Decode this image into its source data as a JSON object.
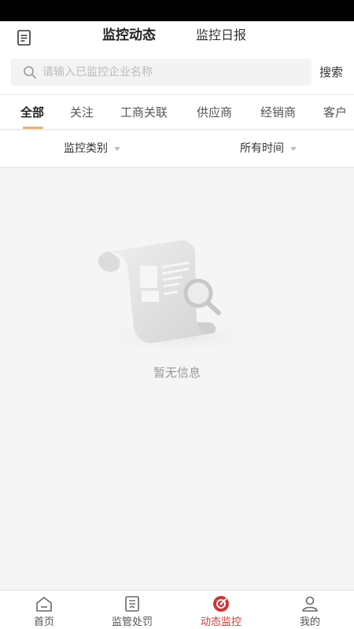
{
  "header": {
    "tabs": [
      {
        "label": "监控动态",
        "active": true
      },
      {
        "label": "监控日报",
        "active": false
      }
    ]
  },
  "search": {
    "placeholder": "请输入已监控企业名称",
    "value": "",
    "button_label": "搜索"
  },
  "categories": [
    {
      "label": "全部",
      "active": true
    },
    {
      "label": "关注"
    },
    {
      "label": "工商关联"
    },
    {
      "label": "供应商"
    },
    {
      "label": "经销商"
    },
    {
      "label": "客户"
    }
  ],
  "filters": {
    "type_label": "监控类别",
    "time_label": "所有时间"
  },
  "empty_state": {
    "message": "暂无信息"
  },
  "tabbar": [
    {
      "label": "首页",
      "icon": "home-icon"
    },
    {
      "label": "监管处罚",
      "icon": "document-icon"
    },
    {
      "label": "动态监控",
      "icon": "monitor-icon",
      "active": true
    },
    {
      "label": "我的",
      "icon": "user-icon"
    }
  ],
  "colors": {
    "accent_underline": "#e8b57b",
    "active_tab": "#d33333"
  }
}
